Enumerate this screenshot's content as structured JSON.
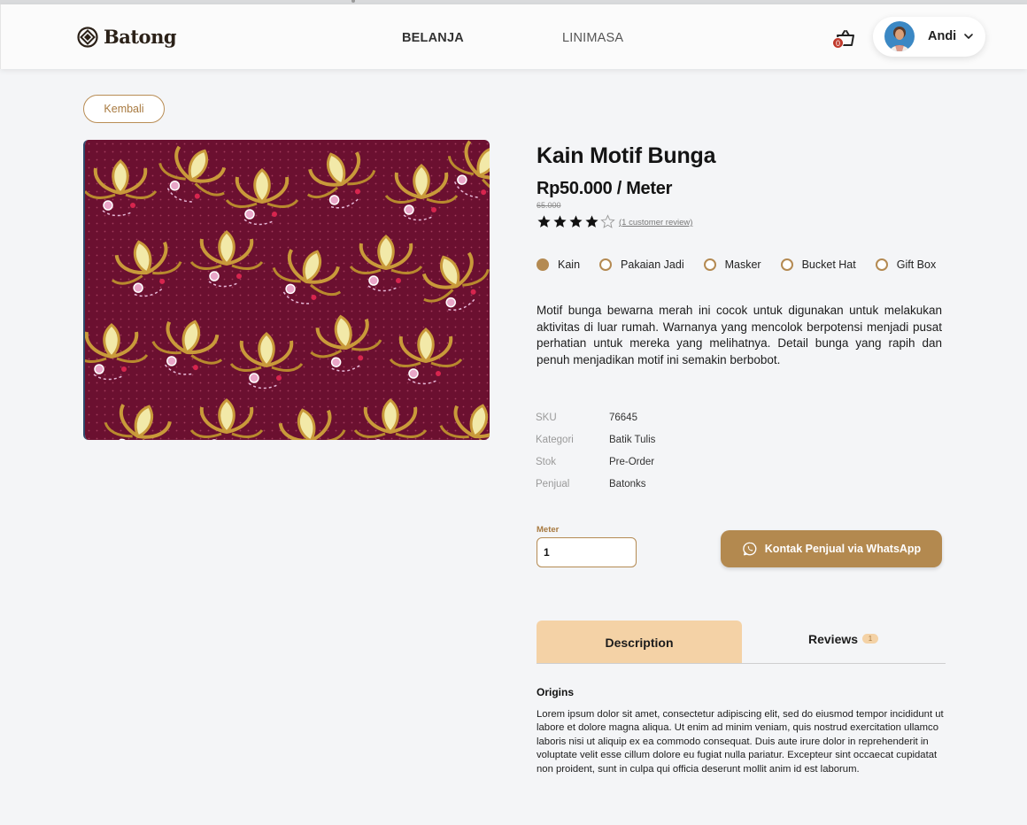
{
  "brand": {
    "name": "Batong"
  },
  "nav": {
    "items": [
      "BELANJA",
      "LINIMASA"
    ]
  },
  "cart": {
    "count": "0"
  },
  "user": {
    "name": "Andi"
  },
  "back_button": {
    "label": "Kembali"
  },
  "product": {
    "title": "Kain Motif Bunga",
    "price": "Rp50.000 / Meter",
    "old_price": "65.000",
    "rating": 4,
    "rating_max": 5,
    "review_link": "(1 customer review)",
    "variants": [
      {
        "label": "Kain",
        "selected": true
      },
      {
        "label": "Pakaian Jadi",
        "selected": false
      },
      {
        "label": "Masker",
        "selected": false
      },
      {
        "label": "Bucket Hat",
        "selected": false
      },
      {
        "label": "Gift Box",
        "selected": false
      }
    ],
    "description": "Motif bunga bewarna merah ini cocok untuk digunakan untuk melakukan aktivitas di luar rumah. Warnanya yang mencolok berpotensi menjadi pusat perhatian untuk mereka yang melihatnya. Detail bunga yang rapih dan penuh menjadikan motif ini semakin berbobot.",
    "specs": [
      {
        "key": "SKU",
        "value": "76645"
      },
      {
        "key": "Kategori",
        "value": "Batik Tulis"
      },
      {
        "key": "Stok",
        "value": "Pre-Order"
      },
      {
        "key": "Penjual",
        "value": "Batonks"
      }
    ]
  },
  "quantity": {
    "label": "Meter",
    "value": "1"
  },
  "contact_button": {
    "label": "Kontak Penjual via WhatsApp",
    "icon": "whatsapp-icon"
  },
  "tabs": {
    "description_label": "Description",
    "reviews_label": "Reviews",
    "reviews_count": "1"
  },
  "content": {
    "heading": "Origins",
    "body": "Lorem ipsum dolor sit amet, consectetur adipiscing elit, sed do eiusmod tempor incididunt ut labore et dolore magna aliqua. Ut enim ad minim veniam, quis nostrud exercitation ullamco laboris nisi ut aliquip ex ea commodo consequat. Duis aute irure dolor in reprehenderit in voluptate velit esse cillum dolore eu fugiat nulla pariatur. Excepteur sint occaecat cupidatat non proident, sunt in culpa qui officia deserunt mollit anim id est laborum."
  },
  "colors": {
    "accent": "#b3894f",
    "tab_active": "#f4d2a6",
    "fabric_base": "#6b1030",
    "badge": "#c0392b"
  }
}
